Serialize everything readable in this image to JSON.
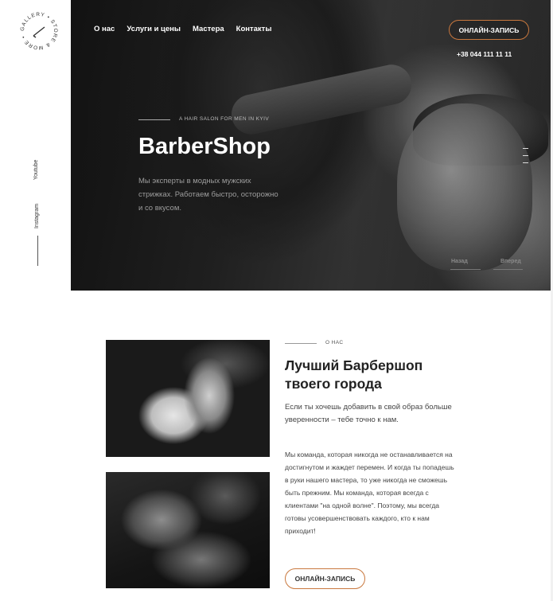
{
  "sidebar": {
    "logo": {
      "ring_text": "GALLERY • STORE & MORE •",
      "icon": "razor-icon"
    },
    "social": [
      {
        "label": "Youtube"
      },
      {
        "label": "Instagram"
      }
    ]
  },
  "nav": {
    "items": [
      {
        "label": "О нас"
      },
      {
        "label": "Услуги и цены"
      },
      {
        "label": "Мастера"
      },
      {
        "label": "Контакты"
      }
    ],
    "cta_label": "ОНЛАЙН-ЗАПИСЬ",
    "phone": "+38 044 111 11 11"
  },
  "hero": {
    "tagline": "A HAIR SALON FOR MEN IN KYIV",
    "title": "BarberShop",
    "description": "Мы эксперты в модных мужских стрижках. Работаем быстро, осторожно и со вкусом.",
    "prev_label": "Назад",
    "next_label": "Вперед"
  },
  "about": {
    "label": "О НАС",
    "title": "Лучший Барбершоп твоего города",
    "paragraph1": "Если ты хочешь добавить в свой образ больше уверенности – тебе точно к нам.",
    "paragraph2": "Мы команда, которая никогда не останавливается на достигнутом и жаждет перемен. И когда ты попадешь в руки нашего мастера, то уже никогда не сможешь быть прежним. Мы команда, которая всегда с клиентами \"на одной волне\". Поэтому, мы всегда готовы усовершенствовать каждого, кто к нам приходит!",
    "cta_label": "ОНЛАЙН-ЗАПИСЬ"
  },
  "colors": {
    "accent": "#c9783e",
    "hero_bg": "#2a2a2a",
    "text": "#222222"
  }
}
